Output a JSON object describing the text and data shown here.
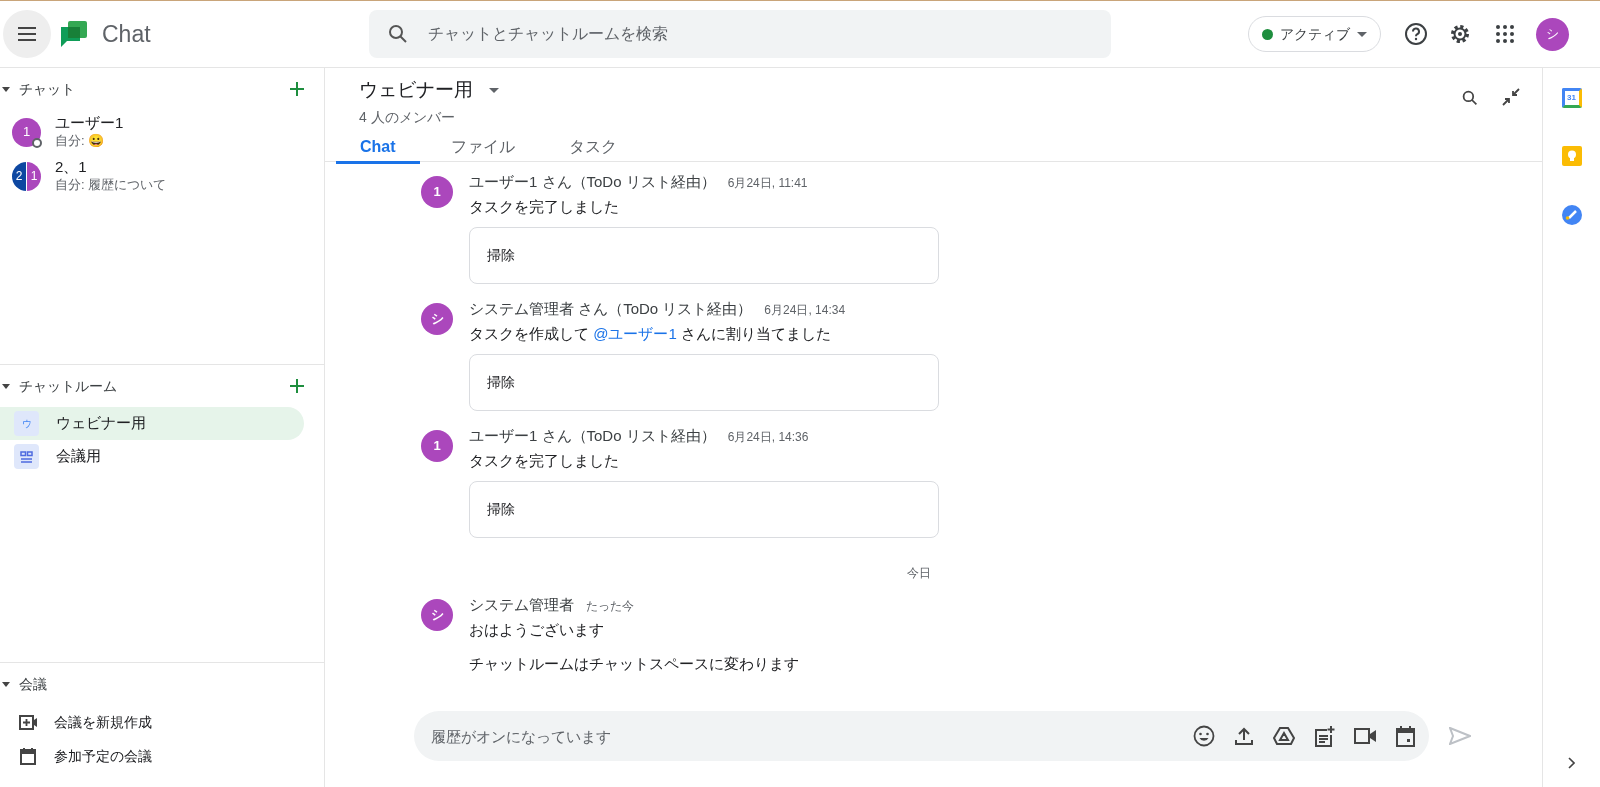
{
  "header": {
    "app_name": "Chat",
    "search": {
      "placeholder": "チャットとチャットルームを検索"
    },
    "status": "アクティブ",
    "avatar": "シ"
  },
  "sidebar": {
    "sections": [
      {
        "kind": "chats",
        "title": "チャット",
        "expanded": true,
        "items": [
          {
            "kind": "dm",
            "avatar": "1",
            "name": "ユーザー1",
            "preview": "自分: 😀",
            "selected": false
          },
          {
            "kind": "group",
            "avatar": [
              "2",
              "1"
            ],
            "name": "2、1",
            "preview": "自分: 履歴について",
            "selected": false
          }
        ]
      },
      {
        "kind": "rooms",
        "title": "チャットルーム",
        "expanded": true,
        "items": [
          {
            "kind": "letter",
            "icon": "ウ",
            "name": "ウェビナー用",
            "selected": true
          },
          {
            "kind": "grid",
            "name": "会議用",
            "selected": false
          }
        ]
      },
      {
        "kind": "meetings",
        "title": "会議",
        "expanded": true,
        "items": [
          {
            "kind": "video",
            "name": "会議を新規作成"
          },
          {
            "kind": "calendar",
            "name": "参加予定の会議"
          }
        ]
      }
    ]
  },
  "room": {
    "title": "ウェビナー用",
    "members": "4 人のメンバー",
    "tabs": [
      {
        "label": "Chat",
        "selected": true
      },
      {
        "label": "ファイル",
        "selected": false
      },
      {
        "label": "タスク",
        "selected": false
      }
    ]
  },
  "messages": [
    {
      "kind": "message",
      "avatar": "1",
      "author": "ユーザー1 さん（ToDo リスト経由）",
      "time": "6月24日, 11:41",
      "lines": [
        {
          "text": "タスクを完了しました"
        }
      ],
      "card": "掃除"
    },
    {
      "kind": "message",
      "avatar": "シ",
      "author": "システム管理者 さん（ToDo リスト経由）",
      "time": "6月24日, 14:34",
      "lines": [
        {
          "text": "タスクを作成して ",
          "mention": "@ユーザー1",
          "after": " さんに割り当てました"
        }
      ],
      "card": "掃除"
    },
    {
      "kind": "message",
      "avatar": "1",
      "author": "ユーザー1 さん（ToDo リスト経由）",
      "time": "6月24日, 14:36",
      "lines": [
        {
          "text": "タスクを完了しました"
        }
      ],
      "card": "掃除"
    },
    {
      "kind": "divider",
      "label": "今日"
    },
    {
      "kind": "message",
      "avatar": "シ",
      "author": "システム管理者",
      "time": "たった今",
      "lines": [
        {
          "text": "おはようございます"
        },
        {
          "text": "チャットルームはチャットスペースに変わります"
        }
      ]
    }
  ],
  "composer": {
    "placeholder": "履歴がオンになっています"
  },
  "side_panel": {
    "calendar_day": "31"
  }
}
